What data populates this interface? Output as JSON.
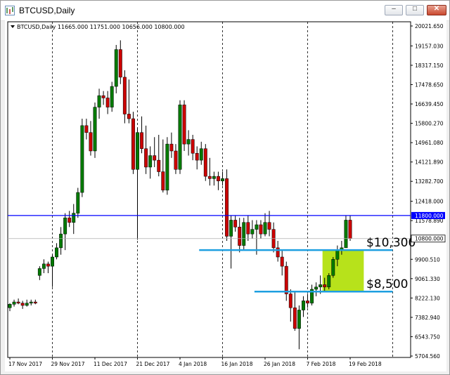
{
  "window": {
    "title": "BTCUSD,Daily",
    "controls": {
      "minimize": "‒",
      "maximize": "□",
      "close": "✕"
    }
  },
  "chart_data": {
    "type": "candlestick",
    "symbol_info": "BTCUSD,Daily  11665.000 11751.000 10656.000 10800.000",
    "price_axis_labels": [
      "20021.650",
      "19157.030",
      "18317.150",
      "17478.650",
      "16639.450",
      "15800.270",
      "14961.080",
      "14121.890",
      "13282.700",
      "12418.000",
      "11578.890",
      "10739.710",
      "9900.510",
      "9061.330",
      "8222.130",
      "7382.940",
      "6543.750",
      "5704.560"
    ],
    "price_axis_values": [
      20021.65,
      19157.03,
      18317.15,
      17478.65,
      16639.45,
      15800.27,
      14961.08,
      14121.89,
      13282.7,
      12418.0,
      11578.89,
      10739.71,
      9900.51,
      9061.33,
      8222.13,
      7382.94,
      6543.75,
      5704.56
    ],
    "date_labels": [
      "17 Nov 2017",
      "29 Nov 2017",
      "11 Dec 2017",
      "21 Dec 2017",
      "4 Jan 2018",
      "16 Jan 2018",
      "26 Jan 2018",
      "7 Feb 2018",
      "19 Feb 2018"
    ],
    "date_label_index": [
      0,
      10,
      20,
      30,
      40,
      50,
      60,
      70,
      80
    ],
    "vertical_grid_index": [
      10,
      30,
      50,
      70,
      90
    ],
    "hline_price": 11800,
    "hline_label": "11800.000",
    "current_price": 10800,
    "current_price_label": "10800.000",
    "candles": [
      [
        7800,
        8000,
        7650,
        7950
      ],
      [
        7950,
        8150,
        7850,
        8050
      ],
      [
        8050,
        8200,
        7950,
        8000
      ],
      [
        8000,
        8100,
        7750,
        7900
      ],
      [
        7900,
        8150,
        7850,
        8000
      ],
      [
        8000,
        8150,
        7900,
        8050
      ],
      [
        8050,
        8150,
        7950,
        8000
      ],
      [
        9200,
        9600,
        9000,
        9500
      ],
      [
        9500,
        9900,
        9300,
        9700
      ],
      [
        9700,
        9800,
        9300,
        9600
      ],
      [
        9600,
        10100,
        8700,
        10000
      ],
      [
        10000,
        10600,
        9900,
        10400
      ],
      [
        10400,
        11300,
        10100,
        11000
      ],
      [
        11000,
        11900,
        10300,
        11700
      ],
      [
        11700,
        12000,
        11300,
        11500
      ],
      [
        11500,
        12300,
        11000,
        11900
      ],
      [
        11900,
        13000,
        11700,
        12800
      ],
      [
        12800,
        16000,
        12600,
        15700
      ],
      [
        15700,
        16000,
        15100,
        15400
      ],
      [
        15400,
        15900,
        14400,
        14600
      ],
      [
        14600,
        16700,
        14300,
        16500
      ],
      [
        16500,
        17300,
        16000,
        17000
      ],
      [
        17000,
        17200,
        16600,
        16900
      ],
      [
        16900,
        17200,
        16200,
        16500
      ],
      [
        16500,
        17600,
        16300,
        17400
      ],
      [
        17400,
        19200,
        17100,
        19000
      ],
      [
        19000,
        19400,
        17500,
        17800
      ],
      [
        17800,
        18100,
        15800,
        16200
      ],
      [
        16200,
        17700,
        15800,
        16000
      ],
      [
        16000,
        16300,
        13600,
        13800
      ],
      [
        13800,
        15600,
        10750,
        15400
      ],
      [
        15400,
        16100,
        14500,
        14700
      ],
      [
        14700,
        15700,
        13600,
        13900
      ],
      [
        13900,
        14800,
        13400,
        14400
      ],
      [
        14400,
        15200,
        13900,
        14200
      ],
      [
        14200,
        15300,
        13500,
        13700
      ],
      [
        13700,
        15100,
        12800,
        12900
      ],
      [
        12900,
        15200,
        12700,
        14900
      ],
      [
        14900,
        15400,
        14300,
        14600
      ],
      [
        14600,
        14900,
        13600,
        13800
      ],
      [
        13800,
        16800,
        13600,
        16600
      ],
      [
        16600,
        16800,
        14600,
        14900
      ],
      [
        14900,
        15500,
        14400,
        15100
      ],
      [
        15100,
        15300,
        14200,
        14500
      ],
      [
        14500,
        14800,
        13800,
        14200
      ],
      [
        14200,
        15000,
        14000,
        14700
      ],
      [
        14700,
        14900,
        13300,
        13500
      ],
      [
        13500,
        14300,
        13100,
        13400
      ],
      [
        13400,
        13700,
        13100,
        13500
      ],
      [
        13500,
        13700,
        12900,
        13300
      ],
      [
        13300,
        13700,
        13100,
        13400
      ],
      [
        13400,
        13800,
        10700,
        10900
      ],
      [
        10900,
        11800,
        9500,
        11600
      ],
      [
        11600,
        11800,
        11100,
        11300
      ],
      [
        11300,
        11700,
        10200,
        10500
      ],
      [
        10500,
        11700,
        10300,
        11500
      ],
      [
        11500,
        11800,
        10700,
        11000
      ],
      [
        11000,
        11600,
        10800,
        11200
      ],
      [
        11200,
        11600,
        10100,
        11400
      ],
      [
        11400,
        11600,
        10800,
        11000
      ],
      [
        11000,
        11900,
        10900,
        11500
      ],
      [
        11500,
        12000,
        10900,
        11200
      ],
      [
        11200,
        11500,
        10200,
        10400
      ],
      [
        10400,
        10700,
        9800,
        10000
      ],
      [
        10000,
        10300,
        9200,
        9600
      ],
      [
        9600,
        9800,
        8100,
        8400
      ],
      [
        8400,
        8600,
        7200,
        7800
      ],
      [
        7800,
        8500,
        6800,
        6900
      ],
      [
        6900,
        7900,
        6000,
        7700
      ],
      [
        7700,
        8300,
        7400,
        8100
      ],
      [
        8100,
        8400,
        7800,
        8000
      ],
      [
        8000,
        8800,
        7900,
        8600
      ],
      [
        8600,
        8900,
        8300,
        8700
      ],
      [
        8700,
        9200,
        8400,
        8800
      ],
      [
        8800,
        9100,
        8500,
        8700
      ],
      [
        8700,
        9300,
        8600,
        9200
      ],
      [
        9200,
        10000,
        9100,
        9900
      ],
      [
        9900,
        10500,
        9600,
        10300
      ],
      [
        10300,
        10700,
        10100,
        10400
      ],
      [
        10400,
        11800,
        10400,
        11600
      ],
      [
        11600,
        11800,
        10700,
        10800
      ]
    ],
    "up_color": "#007a00",
    "down_color": "#cc0000",
    "hline_color": "#0000ff",
    "annotations": [
      {
        "label": "$10,300",
        "price": 10300
      },
      {
        "label": "$8,500",
        "price": 8500
      }
    ],
    "annotation_line_color": "#1e9fe0",
    "zone_color": "#b7e21b"
  }
}
